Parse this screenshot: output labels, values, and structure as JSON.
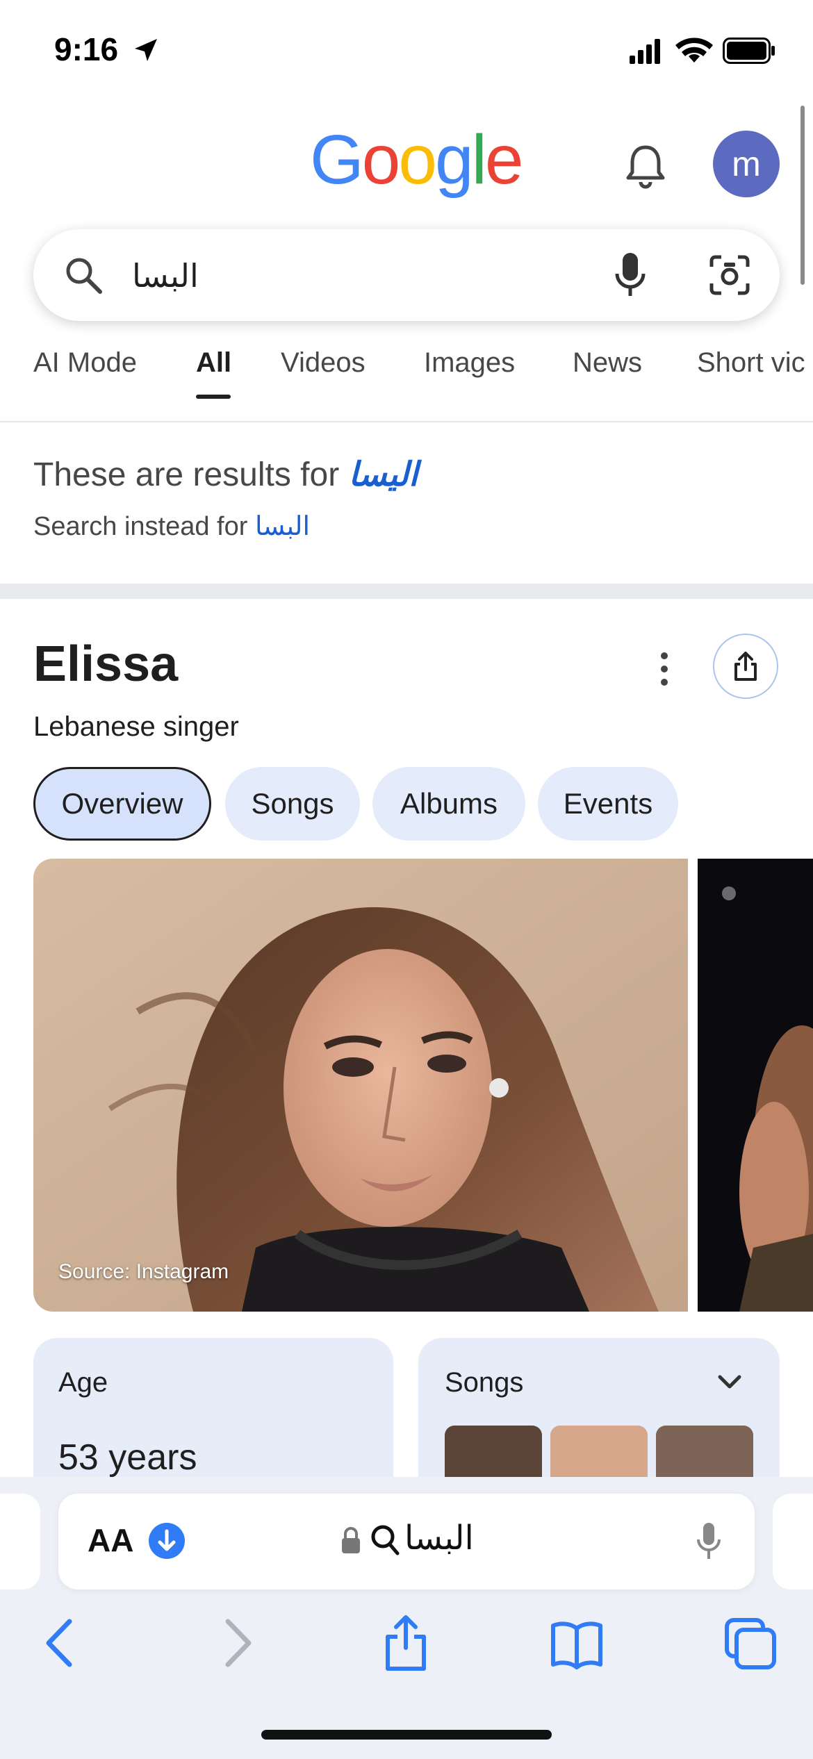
{
  "status_bar": {
    "time": "9:16"
  },
  "header": {
    "logo_letters": [
      {
        "ch": "G",
        "color": "#4285F4"
      },
      {
        "ch": "o",
        "color": "#EA4335"
      },
      {
        "ch": "o",
        "color": "#FBBC05"
      },
      {
        "ch": "g",
        "color": "#4285F4"
      },
      {
        "ch": "l",
        "color": "#34A853"
      },
      {
        "ch": "e",
        "color": "#EA4335"
      }
    ],
    "avatar_letter": "m"
  },
  "search": {
    "query": "البسا"
  },
  "tabs": [
    "AI Mode",
    "All",
    "Videos",
    "Images",
    "News",
    "Short vic"
  ],
  "spelling": {
    "results_prefix": "These are results for ",
    "results_term": "اليسا",
    "instead_prefix": "Search instead for ",
    "instead_term": "البسا"
  },
  "knowledge_panel": {
    "title": "Elissa",
    "subtitle": "Lebanese singer",
    "chips": [
      "Overview",
      "Songs",
      "Albums",
      "Events"
    ],
    "image_source": "Source: Instagram",
    "age_label": "Age",
    "age_value": "53 years",
    "songs_label": "Songs"
  },
  "safari": {
    "aa_label": "AA",
    "address_text": "البسا"
  },
  "colors": {
    "link_blue": "#1a5fd0",
    "chip_bg": "#e4ebfa",
    "avatar_bg": "#5c6bc0",
    "safari_blue": "#2f7cf6"
  }
}
